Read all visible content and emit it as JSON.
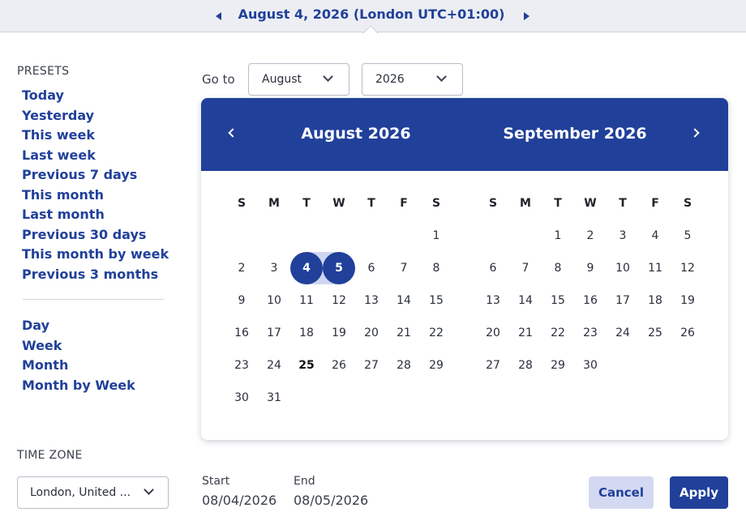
{
  "header": {
    "title": "August 4, 2026 (London UTC+01:00)",
    "prev_icon": "triangle-left-icon",
    "next_icon": "triangle-right-icon"
  },
  "presets": {
    "heading": "PRESETS",
    "items": [
      "Today",
      "Yesterday",
      "This week",
      "Last week",
      "Previous 7 days",
      "This month",
      "Last month",
      "Previous 30 days",
      "This month by week",
      "Previous 3 months"
    ],
    "views": [
      "Day",
      "Week",
      "Month",
      "Month by Week"
    ]
  },
  "timezone": {
    "heading": "TIME ZONE",
    "value": "London, United ..."
  },
  "goto": {
    "label": "Go to",
    "month": "August",
    "year": "2026"
  },
  "calendar": {
    "weekdays": [
      "S",
      "M",
      "T",
      "W",
      "T",
      "F",
      "S"
    ],
    "months": [
      {
        "title": "August 2026",
        "weeks": [
          [
            "",
            "",
            "",
            "",
            "",
            "",
            "1"
          ],
          [
            "2",
            "3",
            "4",
            "5",
            "6",
            "7",
            "8"
          ],
          [
            "9",
            "10",
            "11",
            "12",
            "13",
            "14",
            "15"
          ],
          [
            "16",
            "17",
            "18",
            "19",
            "20",
            "21",
            "22"
          ],
          [
            "23",
            "24",
            "25",
            "26",
            "27",
            "28",
            "29"
          ],
          [
            "30",
            "31",
            "",
            "",
            "",
            "",
            ""
          ]
        ]
      },
      {
        "title": "September 2026",
        "weeks": [
          [
            "",
            "",
            "1",
            "2",
            "3",
            "4",
            "5"
          ],
          [
            "6",
            "7",
            "8",
            "9",
            "10",
            "11",
            "12"
          ],
          [
            "13",
            "14",
            "15",
            "16",
            "17",
            "18",
            "19"
          ],
          [
            "20",
            "21",
            "22",
            "23",
            "24",
            "25",
            "26"
          ],
          [
            "27",
            "28",
            "29",
            "30",
            "",
            "",
            ""
          ]
        ]
      }
    ],
    "selected_start": "4",
    "selected_end": "5",
    "today": "25",
    "accent_color": "#21409a",
    "range_color": "#cfd6f0"
  },
  "footer": {
    "start_label": "Start",
    "start_value": "08/04/2026",
    "end_label": "End",
    "end_value": "08/05/2026",
    "cancel_label": "Cancel",
    "apply_label": "Apply"
  }
}
